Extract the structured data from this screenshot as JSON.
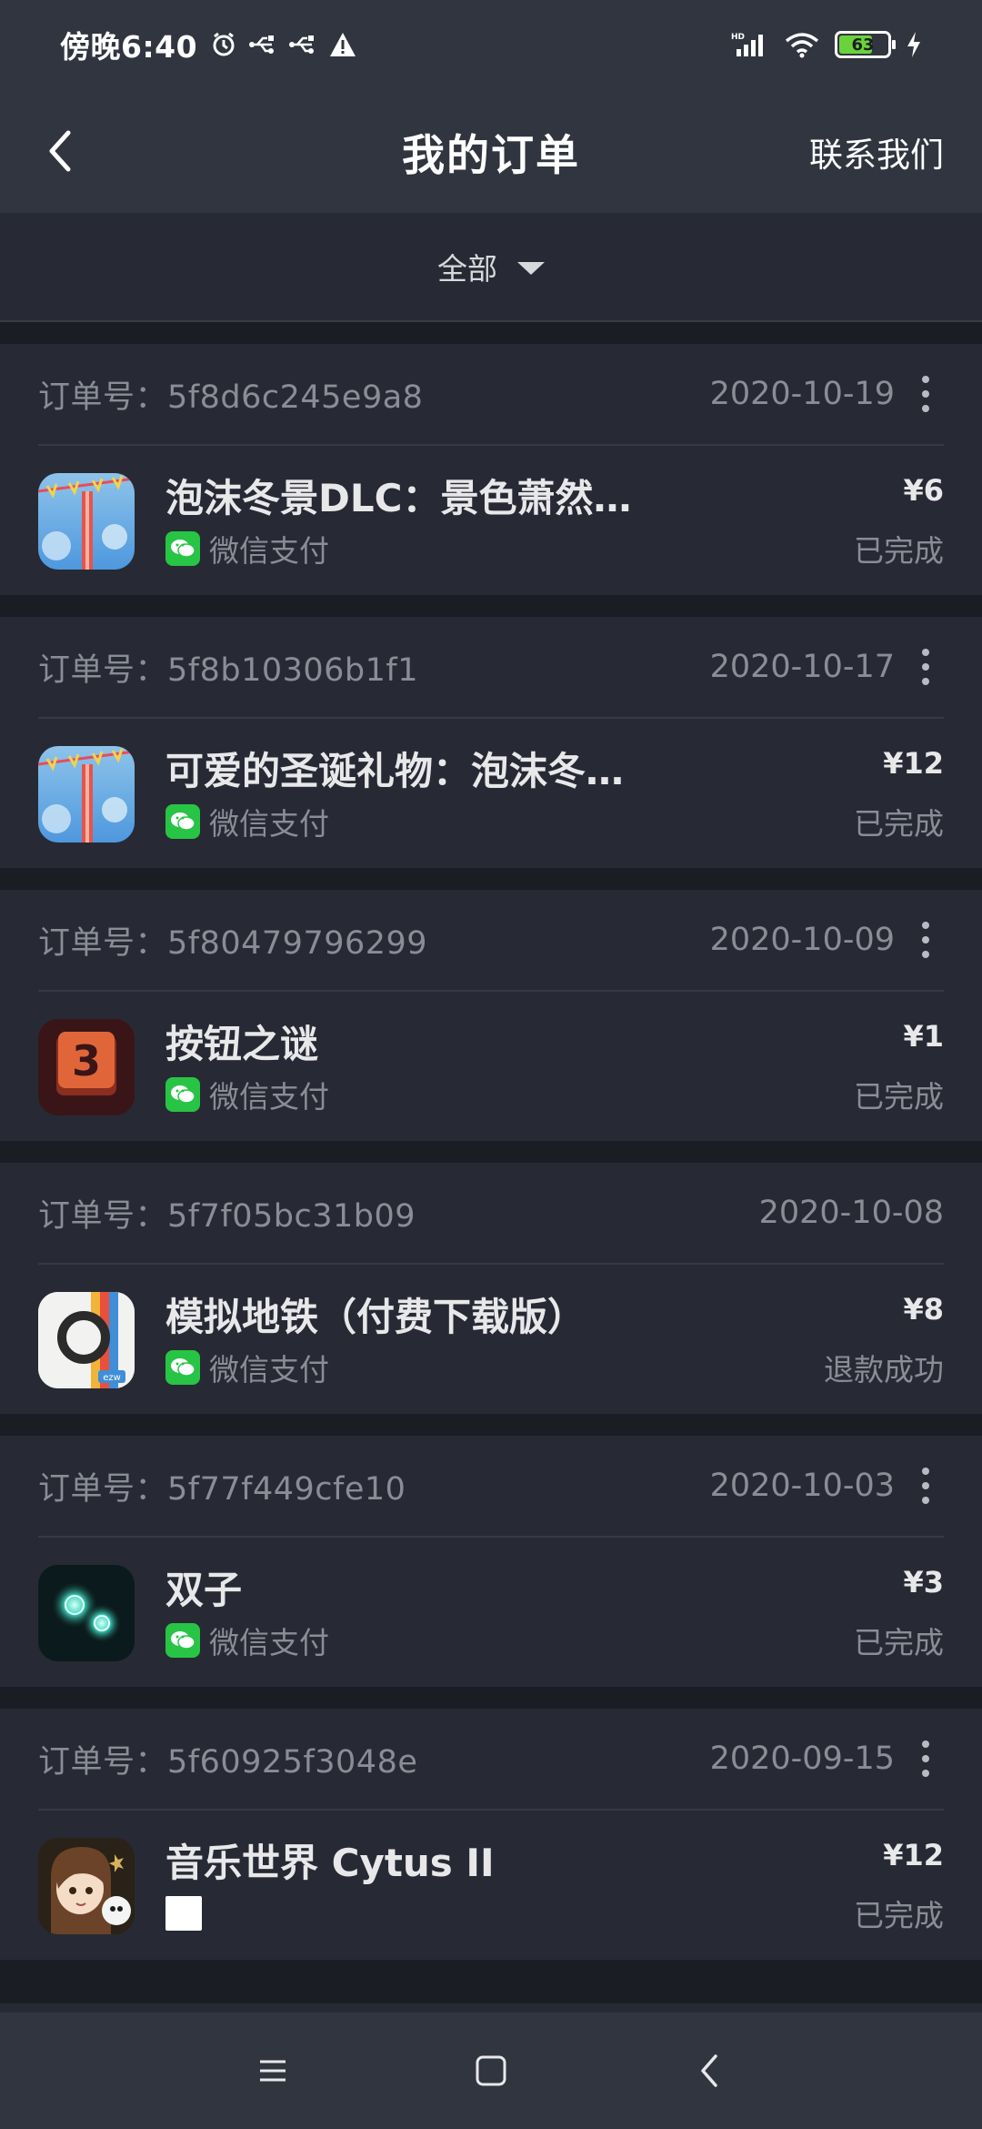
{
  "status_bar": {
    "time": "傍晚6:40",
    "battery_level": "63"
  },
  "header": {
    "title": "我的订单",
    "contact_label": "联系我们"
  },
  "filter": {
    "selected": "全部"
  },
  "orders": [
    {
      "order_prefix": "订单号：",
      "order_id": "5f8d6c245e9a8",
      "date": "2020-10-19",
      "product": "泡沫冬景DLC：景色萧然…",
      "payment": "微信支付",
      "price": "¥6",
      "status": "已完成",
      "icon": "winter-scene-icon"
    },
    {
      "order_prefix": "订单号：",
      "order_id": "5f8b10306b1f1",
      "date": "2020-10-17",
      "product": "可爱的圣诞礼物：泡沫冬…",
      "payment": "微信支付",
      "price": "¥12",
      "status": "已完成",
      "icon": "winter-scene-icon"
    },
    {
      "order_prefix": "订单号：",
      "order_id": "5f80479796299",
      "date": "2020-10-09",
      "product": "按钮之谜",
      "payment": "微信支付",
      "price": "¥1",
      "status": "已完成",
      "icon": "number-3-icon"
    },
    {
      "order_prefix": "订单号：",
      "order_id": "5f7f05bc31b09",
      "date": "2020-10-08",
      "product": "模拟地铁（付费下载版）",
      "payment": "微信支付",
      "price": "¥8",
      "status": "退款成功",
      "icon": "mini-metro-icon"
    },
    {
      "order_prefix": "订单号：",
      "order_id": "5f77f449cfe10",
      "date": "2020-10-03",
      "product": "双子",
      "payment": "微信支付",
      "price": "¥3",
      "status": "已完成",
      "icon": "twin-orbs-icon"
    },
    {
      "order_prefix": "订单号：",
      "order_id": "5f60925f3048e",
      "date": "2020-09-15",
      "product": "音乐世界 Cytus II",
      "payment": "",
      "price": "¥12",
      "status": "已完成",
      "icon": "cytus-character-icon"
    }
  ]
}
